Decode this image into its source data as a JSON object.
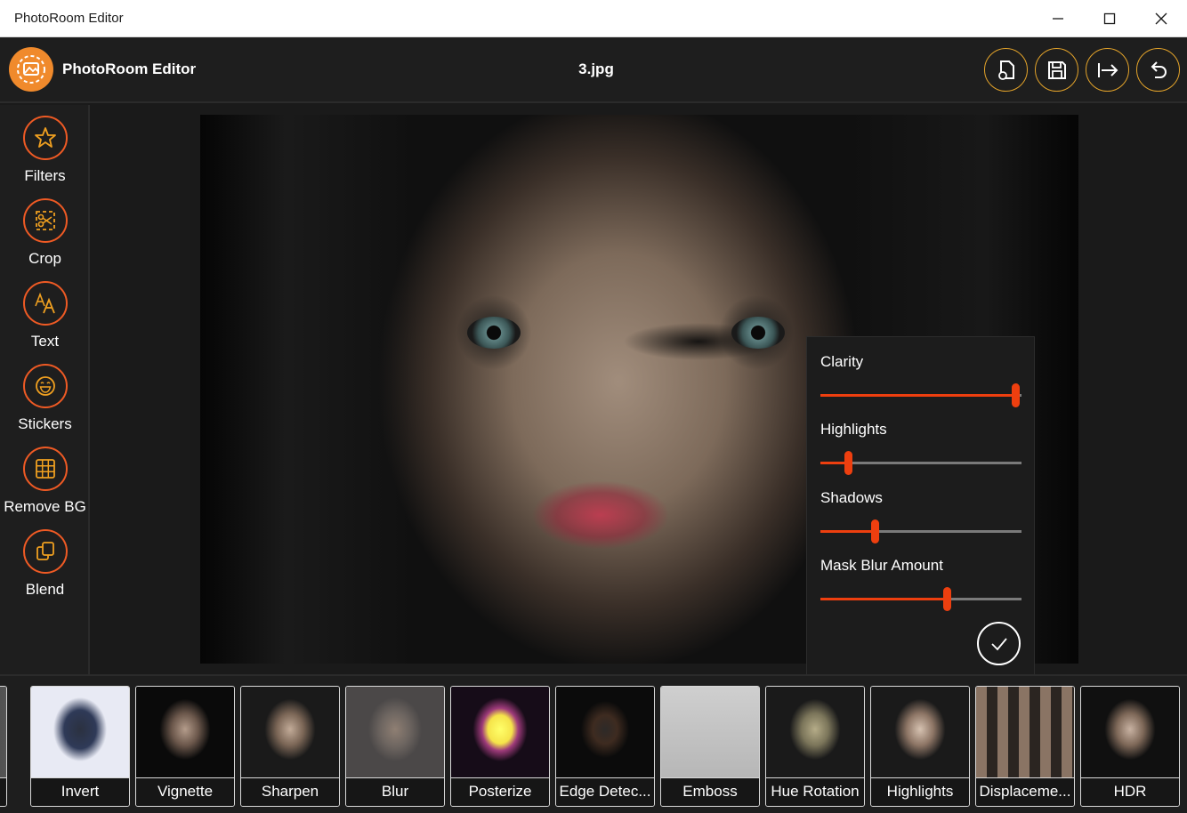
{
  "window": {
    "title": "PhotoRoom Editor"
  },
  "header": {
    "brand": "PhotoRoom Editor",
    "filename": "3.jpg"
  },
  "sidebar": {
    "items": [
      {
        "label": "Filters",
        "icon": "star-icon"
      },
      {
        "label": "Crop",
        "icon": "crop-icon"
      },
      {
        "label": "Text",
        "icon": "text-icon"
      },
      {
        "label": "Stickers",
        "icon": "smiley-icon"
      },
      {
        "label": "Remove BG",
        "icon": "grid-icon"
      },
      {
        "label": "Blend",
        "icon": "layers-icon"
      }
    ]
  },
  "panel": {
    "params": [
      {
        "label": "Clarity",
        "value": 0.97
      },
      {
        "label": "Highlights",
        "value": 0.14
      },
      {
        "label": "Shadows",
        "value": 0.27
      },
      {
        "label": "Mask Blur Amount",
        "value": 0.63
      }
    ]
  },
  "filters": [
    {
      "label": "",
      "style": "partial"
    },
    {
      "label": "Invert",
      "style": "invert"
    },
    {
      "label": "Vignette",
      "style": "vignette"
    },
    {
      "label": "Sharpen",
      "style": "sharpen"
    },
    {
      "label": "Blur",
      "style": "blur"
    },
    {
      "label": "Posterize",
      "style": "posterize"
    },
    {
      "label": "Edge Detec...",
      "style": "edge"
    },
    {
      "label": "Emboss",
      "style": "emboss"
    },
    {
      "label": "Hue Rotation",
      "style": "hue"
    },
    {
      "label": "Highlights",
      "style": "highlights"
    },
    {
      "label": "Displaceme...",
      "style": "displace"
    },
    {
      "label": "HDR",
      "style": "hdr"
    }
  ],
  "colors": {
    "accent": "#ee3f0f",
    "header_button_ring": "#e3a32a",
    "logo": "#f08a2c"
  }
}
